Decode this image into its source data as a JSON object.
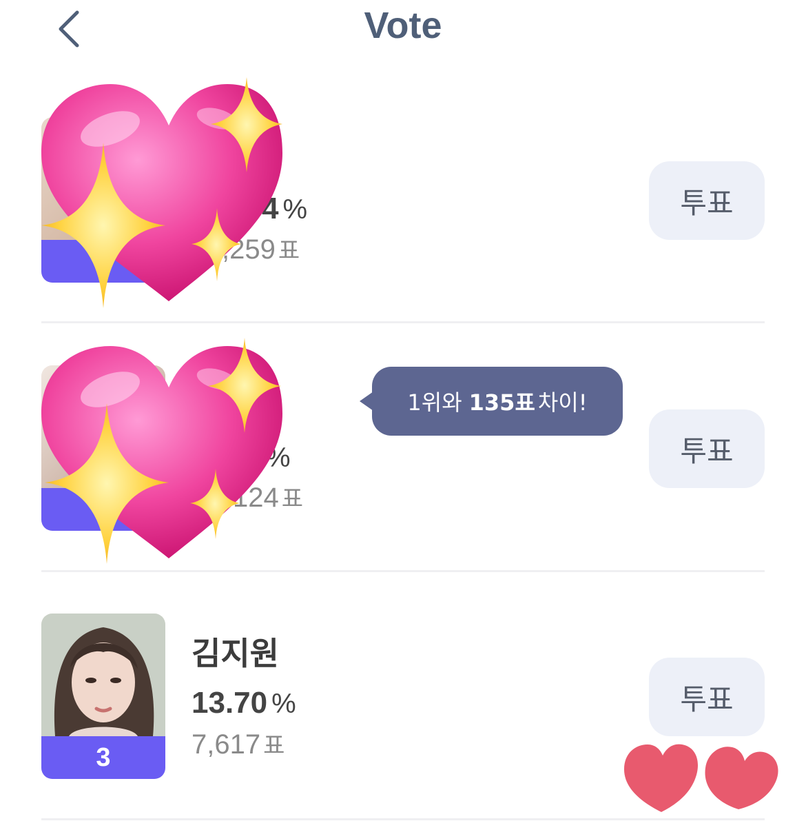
{
  "header": {
    "title": "Vote",
    "back_icon": "chevron-left-icon"
  },
  "tooltip": {
    "prefix": "1위와",
    "diff": "135표",
    "suffix": "차이!"
  },
  "candidates": [
    {
      "name": "",
      "percent_visible": "4",
      "percent_unit": "%",
      "votes_visible": ",259",
      "votes_unit": "표",
      "vote_label": "투표",
      "avatar_icon": "sparkling-heart-icon"
    },
    {
      "name": "",
      "percent_visible": "",
      "percent_unit": "%",
      "votes_visible": "124",
      "votes_unit": "표",
      "vote_label": "투표",
      "avatar_icon": "sparkling-heart-icon"
    },
    {
      "name": "김지원",
      "rank": "3",
      "percent": "13.70",
      "percent_unit": "%",
      "votes": "7,617",
      "votes_unit": "표",
      "vote_label": "투표"
    }
  ],
  "colors": {
    "title": "#4f5f78",
    "rank_badge": "#6a5cf3",
    "vote_button_bg": "#edf0f8",
    "tooltip_bg": "#5d6691",
    "heart_pink": "#f0459f",
    "heart_red": "#e85a6e",
    "sparkle": "#ffd23f"
  }
}
